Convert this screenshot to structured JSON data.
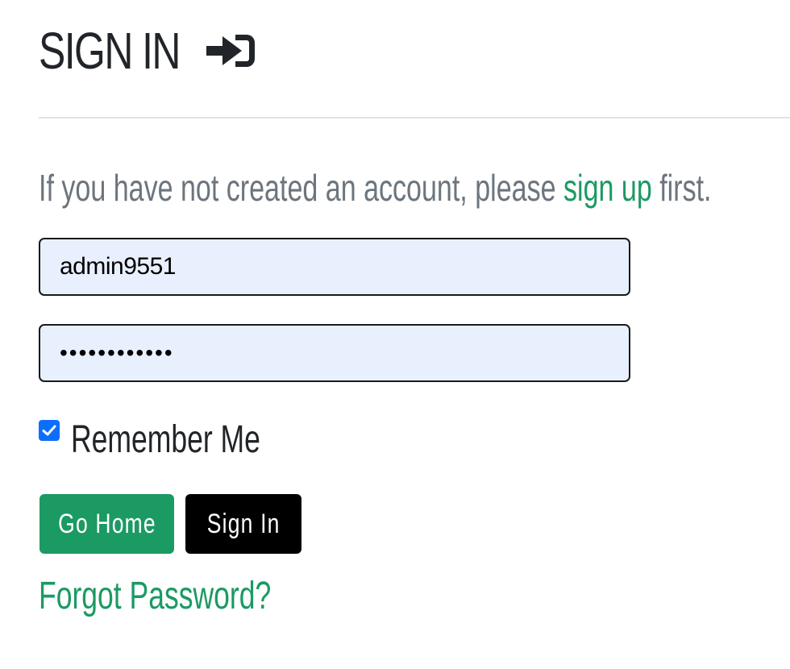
{
  "header": {
    "title": "SIGN IN",
    "icon": "sign-in-icon"
  },
  "intro": {
    "before": "If you have not created an account, please ",
    "link": "sign up",
    "after": " first."
  },
  "form": {
    "username_value": "admin9551",
    "password_value": "••••••••••••",
    "remember_label": "Remember Me",
    "remember_checked": true
  },
  "buttons": {
    "home_label": "Go Home",
    "signin_label": "Sign In"
  },
  "forgot_label": "Forgot Password?",
  "colors": {
    "accent": "#1b9a63",
    "checkbox": "#0d6efd",
    "input_bg": "#e8f0fe",
    "muted_text": "#6c757d"
  }
}
